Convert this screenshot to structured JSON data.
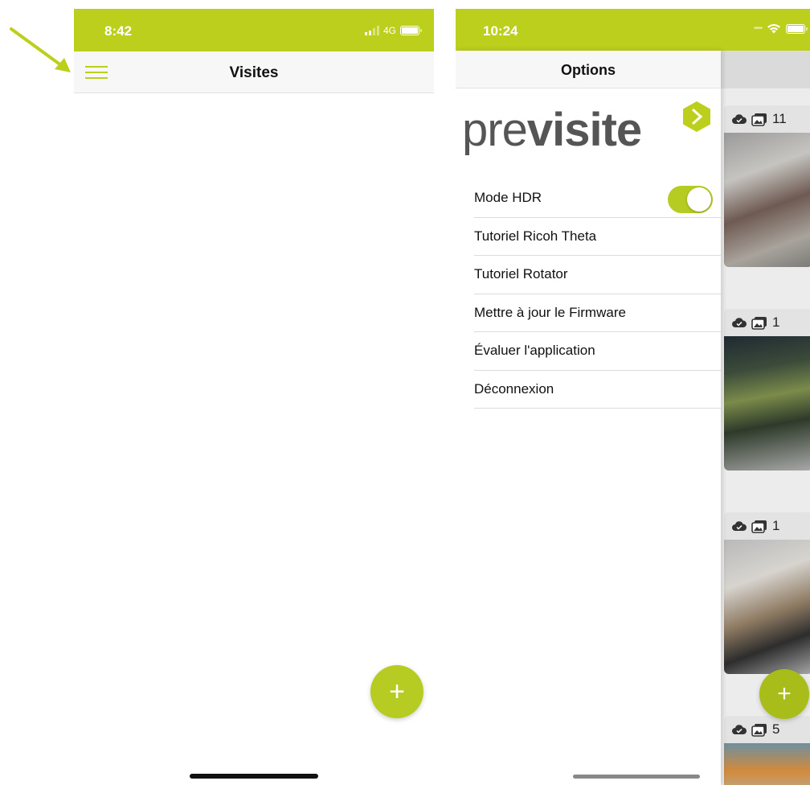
{
  "left_screen": {
    "status_bar": {
      "time": "8:42",
      "network": "4G"
    },
    "nav": {
      "title": "Visites"
    },
    "fab_label": "+"
  },
  "right_screen": {
    "status_bar": {
      "time": "10:24"
    },
    "drawer": {
      "title": "Options",
      "logo": {
        "light_part": "pre",
        "bold_part": "visite"
      },
      "items": [
        {
          "label": "Mode HDR",
          "toggle_on": true
        },
        {
          "label": "Tutoriel Ricoh Theta"
        },
        {
          "label": "Tutoriel Rotator"
        },
        {
          "label": "Mettre à jour le Firmware"
        },
        {
          "label": "Évaluer l'application"
        },
        {
          "label": "Déconnexion"
        }
      ]
    },
    "cards": [
      {
        "photo_count": "11"
      },
      {
        "photo_count": "1"
      },
      {
        "photo_count": "1"
      },
      {
        "photo_count": "5"
      }
    ],
    "fab_label": "+"
  },
  "colors": {
    "accent": "#bccf1c",
    "fab": "#b6cc23",
    "annotation_arrow": "#bccf1c"
  },
  "icons": [
    "menu-icon",
    "signal-icon",
    "battery-icon",
    "wifi-icon",
    "cloud-check-icon",
    "photos-icon",
    "plus-icon",
    "previsite-hex-icon"
  ]
}
